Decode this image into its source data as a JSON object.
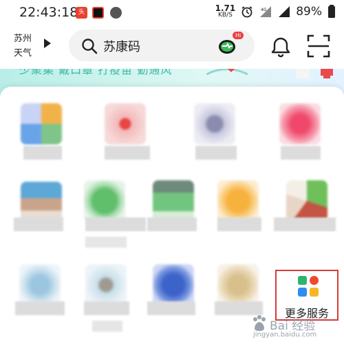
{
  "status_bar": {
    "time": "22:43:18",
    "net_speed_value": "1.71",
    "net_speed_unit": "KB/S",
    "battery": "89%"
  },
  "header": {
    "weather_city": "苏州",
    "weather_label": "天气",
    "search_placeholder": "苏康码",
    "hi_badge": "Hi"
  },
  "banner": {
    "text": "少聚集 戴口罩 打疫苗 勤通风"
  },
  "services": {
    "more_label": "更多服务",
    "more_icon_colors": [
      "#2db66b",
      "#f0482f",
      "#2f8df0",
      "#f5b728"
    ]
  },
  "watermark": {
    "text": "Bai 经验",
    "url": "jingyan.baidu.com"
  },
  "colors": {
    "accent": "#3cb9a4",
    "highlight_border": "#d83a3a"
  }
}
